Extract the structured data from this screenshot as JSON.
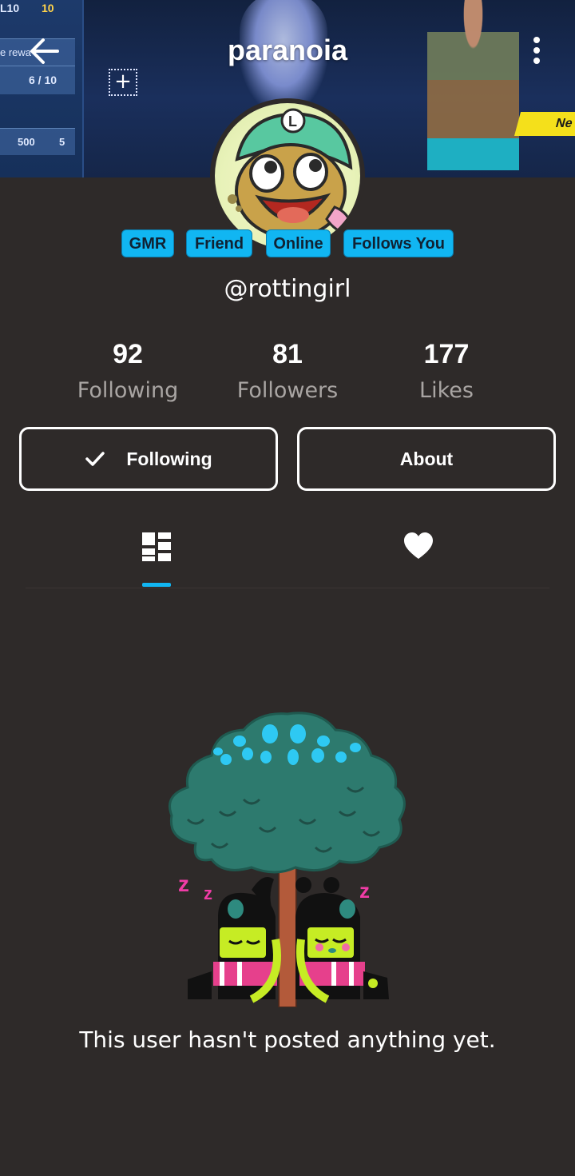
{
  "header": {
    "title": "paranoia",
    "cover": {
      "level_text": "L10",
      "stars_top": "10",
      "reward_text": "e rewa",
      "progress_text": "6 / 10",
      "xp_text": "500",
      "stars_small": "5",
      "tag_text": "Ne"
    }
  },
  "badges": [
    "GMR",
    "Friend",
    "Online",
    "Follows You"
  ],
  "profile": {
    "handle": "@rottingirl"
  },
  "stats": [
    {
      "value": "92",
      "label": "Following"
    },
    {
      "value": "81",
      "label": "Followers"
    },
    {
      "value": "177",
      "label": "Likes"
    }
  ],
  "actions": {
    "following_label": "Following",
    "about_label": "About"
  },
  "tabs": [
    {
      "icon": "grid-layout-icon",
      "active": true
    },
    {
      "icon": "heart-icon",
      "active": false
    }
  ],
  "empty_state": {
    "message": "This user hasn't posted anything yet."
  },
  "colors": {
    "background": "#2e2a29",
    "accent": "#11b6f2",
    "muted_text": "#a9a5a3"
  }
}
